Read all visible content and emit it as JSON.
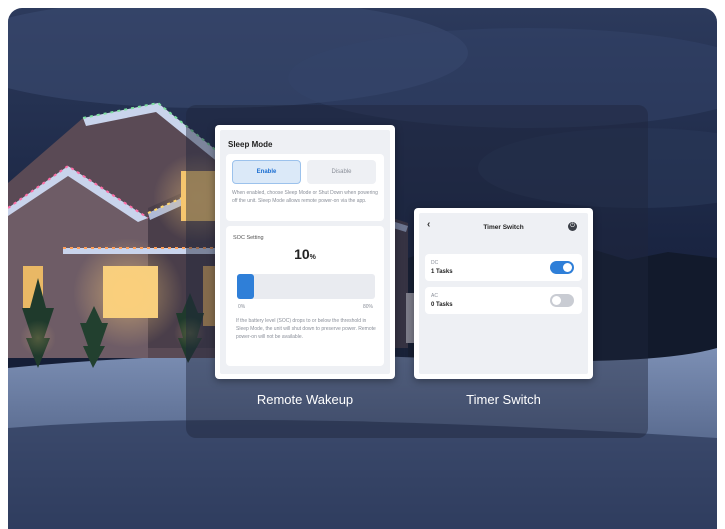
{
  "sleep_mode": {
    "title": "Sleep Mode",
    "enable_label": "Enable",
    "disable_label": "Disable",
    "description": "When enabled, choose Sleep Mode or Shut Down when powering off the unit. Sleep Mode allows remote power-on via the app.",
    "soc_label": "SOC Setting",
    "soc_value": "10",
    "soc_unit": "%",
    "soc_fraction": 0.125,
    "slider_min": "0%",
    "slider_max": "80%",
    "soc_description": "If the battery level (SOC) drops to or below the threshold in Sleep Mode, the unit will shut down to preserve power. Remote power-on will not be available."
  },
  "timer_switch": {
    "back_icon": "chevron-left-icon",
    "title": "Timer Switch",
    "power_icon": "power-icon",
    "rows": [
      {
        "label": "DC",
        "tasks": "1 Tasks",
        "enabled": true
      },
      {
        "label": "AC",
        "tasks": "0 Tasks",
        "enabled": false
      }
    ]
  },
  "captions": {
    "left": "Remote Wakeup",
    "right": "Timer Switch"
  },
  "colors": {
    "accent": "#2f7fd8",
    "toggle_off": "#c9ccd3",
    "sky": "#1a2a48"
  }
}
